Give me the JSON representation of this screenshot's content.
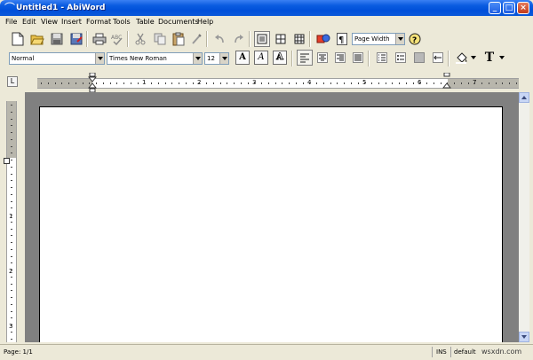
{
  "window": {
    "title": "Untitled1 - AbiWord"
  },
  "menu": [
    "File",
    "Edit",
    "View",
    "Insert",
    "Format",
    "Tools",
    "Table",
    "Documents",
    "Help"
  ],
  "toolbar": {
    "zoom_value": "Page Width",
    "icons": [
      "new-document-icon",
      "open-folder-icon",
      "save-icon",
      "save-as-icon",
      "print-icon",
      "spellcheck-icon",
      "cut-icon",
      "copy-icon",
      "paste-icon",
      "format-painter-icon",
      "undo-icon",
      "redo-icon",
      "normal-view-icon",
      "web-view-icon",
      "print-layout-icon",
      "insert-image-icon",
      "show-formatting-icon",
      "help-icon"
    ]
  },
  "format_toolbar": {
    "style_value": "Normal",
    "font_value": "Times New Roman",
    "size_value": "12",
    "bold_label": "A",
    "italic_label": "A",
    "outline_label": "A",
    "text_color_label": "T"
  },
  "ruler": {
    "h_numbers": [
      "1",
      "2",
      "3",
      "4",
      "5",
      "6",
      "7"
    ],
    "v_numbers": [
      "1",
      "2",
      "3"
    ]
  },
  "status": {
    "page": "Page: 1/1",
    "mode": "INS",
    "lang": "default"
  },
  "watermark": "wsxdn.com",
  "colors": {
    "titlebar": "#0a5ce0",
    "chrome": "#ece9d8",
    "workspace": "#808080",
    "page": "#ffffff"
  }
}
